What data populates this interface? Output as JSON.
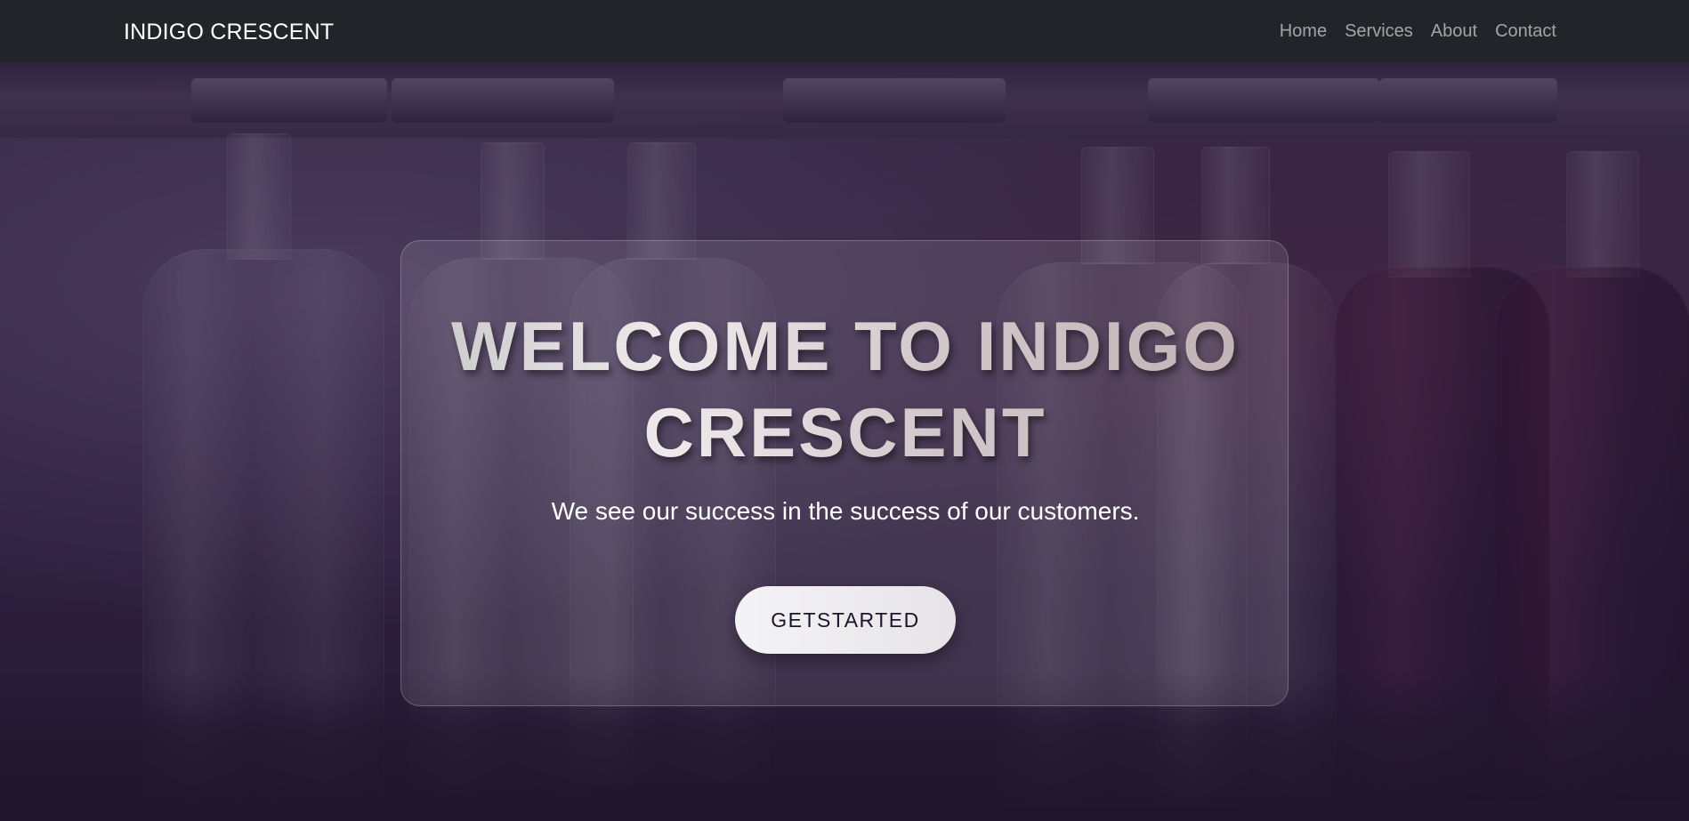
{
  "navbar": {
    "brand": "INDIGO CRESCENT",
    "links": [
      {
        "label": "Home"
      },
      {
        "label": "Services"
      },
      {
        "label": "About"
      },
      {
        "label": "Contact"
      }
    ]
  },
  "hero": {
    "title_line1": "WELCOME TO INDIGO",
    "title_line2": "CRESCENT",
    "subtitle": "We see our success in the success of our customers.",
    "cta_label": "GETSTARTED"
  },
  "colors": {
    "navbar_bg": "#212529",
    "hero_tint": "#2d1e41",
    "button_bg": "#f4f3f5"
  }
}
